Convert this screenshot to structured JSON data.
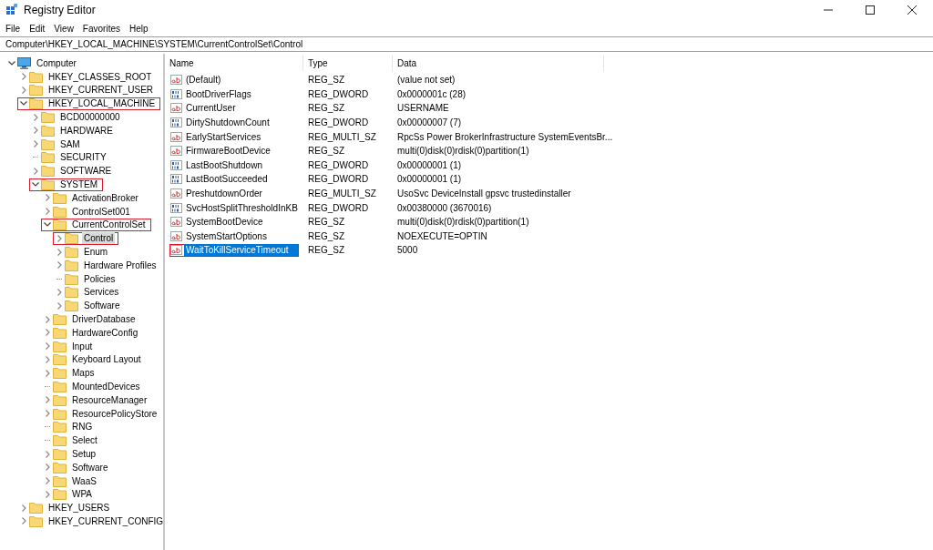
{
  "window": {
    "title": "Registry Editor"
  },
  "menu": [
    "File",
    "Edit",
    "View",
    "Favorites",
    "Help"
  ],
  "address": "Computer\\HKEY_LOCAL_MACHINE\\SYSTEM\\CurrentControlSet\\Control",
  "tree": [
    {
      "label": "Computer",
      "kind": "computer",
      "expandable": true,
      "expanded": true,
      "selected": false,
      "annotated": false,
      "children": [
        {
          "label": "HKEY_CLASSES_ROOT",
          "kind": "folder",
          "expandable": true,
          "expanded": false,
          "selected": false,
          "annotated": false
        },
        {
          "label": "HKEY_CURRENT_USER",
          "kind": "folder",
          "expandable": true,
          "expanded": false,
          "selected": false,
          "annotated": false
        },
        {
          "label": "HKEY_LOCAL_MACHINE",
          "kind": "folder",
          "expandable": true,
          "expanded": true,
          "selected": false,
          "annotated": true,
          "children": [
            {
              "label": "BCD00000000",
              "kind": "folder",
              "expandable": true,
              "expanded": false,
              "selected": false,
              "annotated": false
            },
            {
              "label": "HARDWARE",
              "kind": "folder",
              "expandable": true,
              "expanded": false,
              "selected": false,
              "annotated": false
            },
            {
              "label": "SAM",
              "kind": "folder",
              "expandable": true,
              "expanded": false,
              "selected": false,
              "annotated": false
            },
            {
              "label": "SECURITY",
              "kind": "folder",
              "expandable": false,
              "selected": false,
              "annotated": false
            },
            {
              "label": "SOFTWARE",
              "kind": "folder",
              "expandable": true,
              "expanded": false,
              "selected": false,
              "annotated": false
            },
            {
              "label": "SYSTEM",
              "kind": "folder",
              "expandable": true,
              "expanded": true,
              "selected": false,
              "annotated": true,
              "children": [
                {
                  "label": "ActivationBroker",
                  "kind": "folder",
                  "expandable": true,
                  "expanded": false,
                  "selected": false,
                  "annotated": false
                },
                {
                  "label": "ControlSet001",
                  "kind": "folder",
                  "expandable": true,
                  "expanded": false,
                  "selected": false,
                  "annotated": false
                },
                {
                  "label": "CurrentControlSet",
                  "kind": "folder",
                  "expandable": true,
                  "expanded": true,
                  "selected": false,
                  "annotated": true,
                  "children": [
                    {
                      "label": "Control",
                      "kind": "folder",
                      "expandable": true,
                      "expanded": false,
                      "selected": true,
                      "annotated": true
                    },
                    {
                      "label": "Enum",
                      "kind": "folder",
                      "expandable": true,
                      "expanded": false,
                      "selected": false,
                      "annotated": false
                    },
                    {
                      "label": "Hardware Profiles",
                      "kind": "folder",
                      "expandable": true,
                      "expanded": false,
                      "selected": false,
                      "annotated": false
                    },
                    {
                      "label": "Policies",
                      "kind": "folder",
                      "expandable": false,
                      "selected": false,
                      "annotated": false
                    },
                    {
                      "label": "Services",
                      "kind": "folder",
                      "expandable": true,
                      "expanded": false,
                      "selected": false,
                      "annotated": false
                    },
                    {
                      "label": "Software",
                      "kind": "folder",
                      "expandable": true,
                      "expanded": false,
                      "selected": false,
                      "annotated": false
                    }
                  ]
                },
                {
                  "label": "DriverDatabase",
                  "kind": "folder",
                  "expandable": true,
                  "expanded": false,
                  "selected": false,
                  "annotated": false
                },
                {
                  "label": "HardwareConfig",
                  "kind": "folder",
                  "expandable": true,
                  "expanded": false,
                  "selected": false,
                  "annotated": false
                },
                {
                  "label": "Input",
                  "kind": "folder",
                  "expandable": true,
                  "expanded": false,
                  "selected": false,
                  "annotated": false
                },
                {
                  "label": "Keyboard Layout",
                  "kind": "folder",
                  "expandable": true,
                  "expanded": false,
                  "selected": false,
                  "annotated": false
                },
                {
                  "label": "Maps",
                  "kind": "folder",
                  "expandable": true,
                  "expanded": false,
                  "selected": false,
                  "annotated": false
                },
                {
                  "label": "MountedDevices",
                  "kind": "folder",
                  "expandable": false,
                  "selected": false,
                  "annotated": false
                },
                {
                  "label": "ResourceManager",
                  "kind": "folder",
                  "expandable": true,
                  "expanded": false,
                  "selected": false,
                  "annotated": false
                },
                {
                  "label": "ResourcePolicyStore",
                  "kind": "folder",
                  "expandable": true,
                  "expanded": false,
                  "selected": false,
                  "annotated": false
                },
                {
                  "label": "RNG",
                  "kind": "folder",
                  "expandable": false,
                  "selected": false,
                  "annotated": false
                },
                {
                  "label": "Select",
                  "kind": "folder",
                  "expandable": false,
                  "selected": false,
                  "annotated": false
                },
                {
                  "label": "Setup",
                  "kind": "folder",
                  "expandable": true,
                  "expanded": false,
                  "selected": false,
                  "annotated": false
                },
                {
                  "label": "Software",
                  "kind": "folder",
                  "expandable": true,
                  "expanded": false,
                  "selected": false,
                  "annotated": false
                },
                {
                  "label": "WaaS",
                  "kind": "folder",
                  "expandable": true,
                  "expanded": false,
                  "selected": false,
                  "annotated": false
                },
                {
                  "label": "WPA",
                  "kind": "folder",
                  "expandable": true,
                  "expanded": false,
                  "selected": false,
                  "annotated": false
                }
              ]
            }
          ]
        },
        {
          "label": "HKEY_USERS",
          "kind": "folder",
          "expandable": true,
          "expanded": false,
          "selected": false,
          "annotated": false
        },
        {
          "label": "HKEY_CURRENT_CONFIG",
          "kind": "folder",
          "expandable": true,
          "expanded": false,
          "selected": false,
          "annotated": false
        }
      ]
    }
  ],
  "values": {
    "columns": [
      "Name",
      "Type",
      "Data"
    ],
    "rows": [
      {
        "name": "(Default)",
        "type": "REG_SZ",
        "data": "(value not set)",
        "kind": "string",
        "selected": false,
        "annotated": false
      },
      {
        "name": "BootDriverFlags",
        "type": "REG_DWORD",
        "data": "0x0000001c (28)",
        "kind": "binary",
        "selected": false,
        "annotated": false
      },
      {
        "name": "CurrentUser",
        "type": "REG_SZ",
        "data": "USERNAME",
        "kind": "string",
        "selected": false,
        "annotated": false
      },
      {
        "name": "DirtyShutdownCount",
        "type": "REG_DWORD",
        "data": "0x00000007 (7)",
        "kind": "binary",
        "selected": false,
        "annotated": false
      },
      {
        "name": "EarlyStartServices",
        "type": "REG_MULTI_SZ",
        "data": "RpcSs Power BrokerInfrastructure SystemEventsBr...",
        "kind": "string",
        "selected": false,
        "annotated": false
      },
      {
        "name": "FirmwareBootDevice",
        "type": "REG_SZ",
        "data": "multi(0)disk(0)rdisk(0)partition(1)",
        "kind": "string",
        "selected": false,
        "annotated": false
      },
      {
        "name": "LastBootShutdown",
        "type": "REG_DWORD",
        "data": "0x00000001 (1)",
        "kind": "binary",
        "selected": false,
        "annotated": false
      },
      {
        "name": "LastBootSucceeded",
        "type": "REG_DWORD",
        "data": "0x00000001 (1)",
        "kind": "binary",
        "selected": false,
        "annotated": false
      },
      {
        "name": "PreshutdownOrder",
        "type": "REG_MULTI_SZ",
        "data": "UsoSvc DeviceInstall gpsvc trustedinstaller",
        "kind": "string",
        "selected": false,
        "annotated": false
      },
      {
        "name": "SvcHostSplitThresholdInKB",
        "type": "REG_DWORD",
        "data": "0x00380000 (3670016)",
        "kind": "binary",
        "selected": false,
        "annotated": false
      },
      {
        "name": "SystemBootDevice",
        "type": "REG_SZ",
        "data": "multi(0)disk(0)rdisk(0)partition(1)",
        "kind": "string",
        "selected": false,
        "annotated": false
      },
      {
        "name": "SystemStartOptions",
        "type": "REG_SZ",
        "data": " NOEXECUTE=OPTIN",
        "kind": "string",
        "selected": false,
        "annotated": false
      },
      {
        "name": "WaitToKillServiceTimeout",
        "type": "REG_SZ",
        "data": "5000",
        "kind": "string",
        "selected": true,
        "annotated": true
      }
    ]
  }
}
